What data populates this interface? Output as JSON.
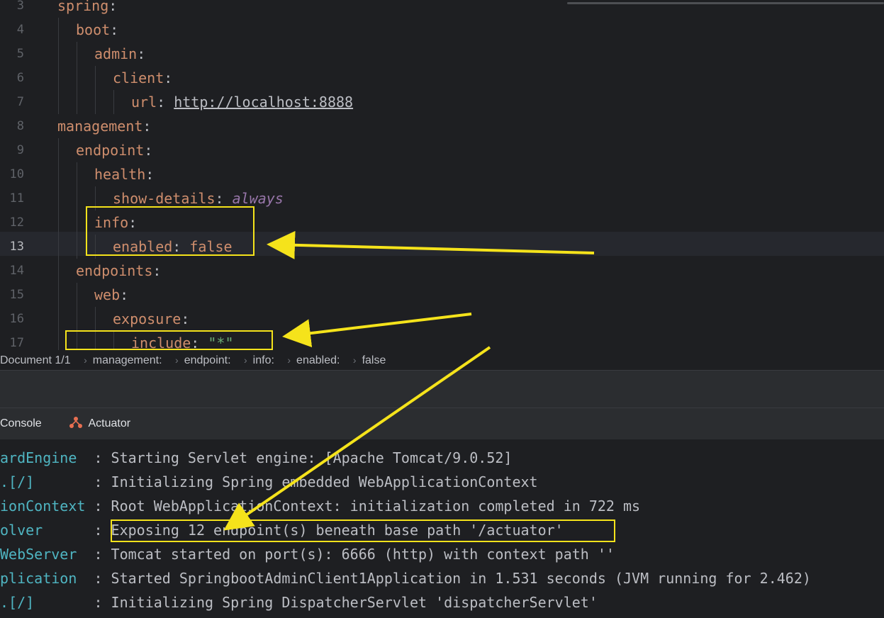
{
  "editor": {
    "lines": [
      {
        "num": "3",
        "indent": 0,
        "key": "spring",
        "colon": ":"
      },
      {
        "num": "4",
        "indent": 1,
        "key": "boot",
        "colon": ":"
      },
      {
        "num": "5",
        "indent": 2,
        "key": "admin",
        "colon": ":"
      },
      {
        "num": "6",
        "indent": 3,
        "key": "client",
        "colon": ":"
      },
      {
        "num": "7",
        "indent": 4,
        "key": "url",
        "colon": ": ",
        "value": "http://localhost:8888",
        "vtype": "url"
      },
      {
        "num": "8",
        "indent": 0,
        "key": "management",
        "colon": ":"
      },
      {
        "num": "9",
        "indent": 1,
        "key": "endpoint",
        "colon": ":"
      },
      {
        "num": "10",
        "indent": 2,
        "key": "health",
        "colon": ":"
      },
      {
        "num": "11",
        "indent": 3,
        "key": "show-details",
        "colon": ": ",
        "value": "always",
        "vtype": "enum"
      },
      {
        "num": "12",
        "indent": 2,
        "key": "info",
        "colon": ":"
      },
      {
        "num": "13",
        "indent": 3,
        "key": "enabled",
        "colon": ": ",
        "value": "false",
        "vtype": "bool",
        "current": true
      },
      {
        "num": "14",
        "indent": 1,
        "key": "endpoints",
        "colon": ":"
      },
      {
        "num": "15",
        "indent": 2,
        "key": "web",
        "colon": ":"
      },
      {
        "num": "16",
        "indent": 3,
        "key": "exposure",
        "colon": ":"
      },
      {
        "num": "17",
        "indent": 4,
        "key": "include",
        "colon": ": ",
        "value": "\"*\"",
        "vtype": "string"
      }
    ]
  },
  "breadcrumb": {
    "document": "Document 1/1",
    "items": [
      "management:",
      "endpoint:",
      "info:",
      "enabled:",
      "false"
    ]
  },
  "tabs": {
    "console": "Console",
    "actuator": "Actuator"
  },
  "console": {
    "lines": [
      {
        "logger": "ardEngine  ",
        "message": ": Starting Servlet engine: [Apache Tomcat/9.0.52]"
      },
      {
        "logger": ".[/]       ",
        "message": ": Initializing Spring embedded WebApplicationContext"
      },
      {
        "logger": "ionContext ",
        "message": ": Root WebApplicationContext: initialization completed in 722 ms"
      },
      {
        "logger": "olver      ",
        "message": ": ",
        "highlight": "Exposing 12 endpoint(s) beneath base path '/actuator'"
      },
      {
        "logger": "WebServer  ",
        "message": ": Tomcat started on port(s): 6666 (http) with context path ''"
      },
      {
        "logger": "plication  ",
        "message": ": Started SpringbootAdminClient1Application in 1.531 seconds (JVM running for 2.462)"
      },
      {
        "logger": ".[/]       ",
        "message": ": Initializing Spring DispatcherServlet 'dispatcherServlet'"
      }
    ]
  },
  "colors": {
    "annotation": "#f5e31b",
    "key": "#cf8e6d",
    "logger": "#4fb5c2"
  }
}
